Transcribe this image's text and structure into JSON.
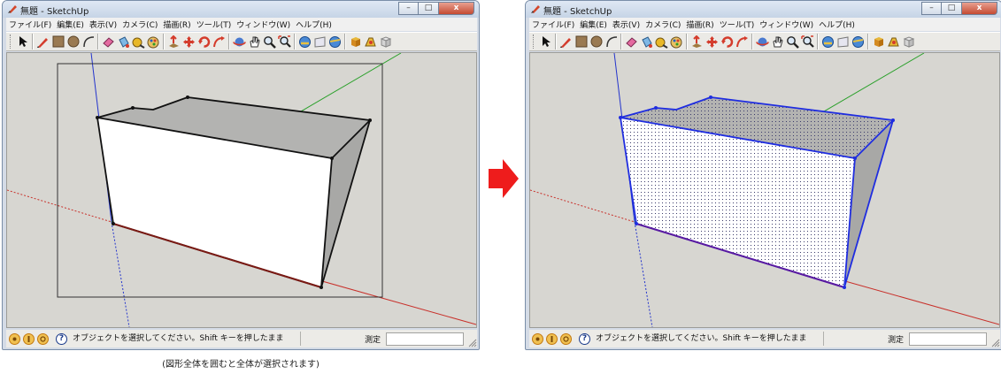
{
  "window": {
    "title": "無題 - SketchUp",
    "minimize_glyph": "–",
    "maximize_glyph": "□",
    "close_glyph": "x"
  },
  "menu": [
    "ファイル(F)",
    "編集(E)",
    "表示(V)",
    "カメラ(C)",
    "描画(R)",
    "ツール(T)",
    "ウィンドウ(W)",
    "ヘルプ(H)"
  ],
  "status": {
    "message": "オブジェクトを選択してください。Shift キーを押したまま",
    "measure_label": "測定",
    "measure_value": ""
  },
  "caption": "(図形全体を囲むと全体が選択されます)",
  "toolbar_icons": [
    "select-icon",
    "pencil-icon",
    "rectangle-icon",
    "circle-icon",
    "arc-icon",
    "eraser-icon",
    "paint-bucket-icon",
    "tape-measure-icon",
    "paint-icon",
    "push-pull-icon",
    "move-icon",
    "rotate-icon",
    "follow-me-icon",
    "orbit-icon",
    "pan-icon",
    "zoom-icon",
    "zoom-extents-icon",
    "previous-view-icon",
    "next-view-icon",
    "shadow-icon",
    "component-icon",
    "materials-icon",
    "scene-icon"
  ],
  "colors": {
    "selection_blue": "#1f2de0",
    "arrow_red": "#ee1c1c",
    "axis_red": "#c8302a",
    "axis_green": "#2aa02a",
    "axis_blue": "#2233cc"
  }
}
